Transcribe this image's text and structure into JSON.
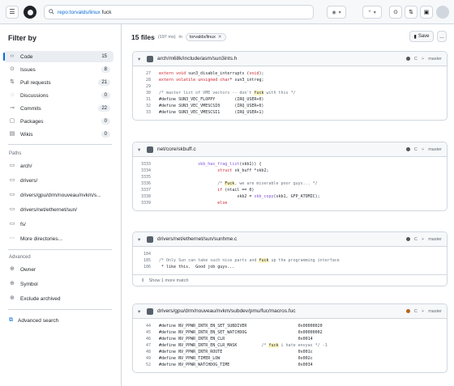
{
  "header": {
    "search_repo": "repo:torvalds/linux",
    "search_term": "fuck"
  },
  "sidebar": {
    "title": "Filter by",
    "items": [
      {
        "label": "Code",
        "count": "15",
        "icon": "code-icon"
      },
      {
        "label": "Issues",
        "count": "8",
        "icon": "issue-icon"
      },
      {
        "label": "Pull requests",
        "count": "21",
        "icon": "pull-request-icon"
      },
      {
        "label": "Discussions",
        "count": "0",
        "icon": "discussion-icon"
      },
      {
        "label": "Commits",
        "count": "22",
        "icon": "commit-icon"
      },
      {
        "label": "Packages",
        "count": "0",
        "icon": "package-icon"
      },
      {
        "label": "Wikis",
        "count": "0",
        "icon": "book-icon"
      }
    ],
    "paths_label": "Paths",
    "paths": [
      {
        "label": "arch/"
      },
      {
        "label": "drivers/"
      },
      {
        "label": "drivers/gpu/drm/nouveau/nvkm/s..."
      },
      {
        "label": "drivers/net/ethernet/sun/"
      },
      {
        "label": "fs/"
      },
      {
        "label": "More directories..."
      }
    ],
    "advanced_label": "Advanced",
    "advanced": [
      {
        "label": "Owner"
      },
      {
        "label": "Symbol"
      },
      {
        "label": "Exclude archived"
      }
    ],
    "advanced_search": "Advanced search"
  },
  "main": {
    "count": "15 files",
    "time": "(197 ms)",
    "in_label": "in",
    "chip": "torvalds/linux",
    "save_label": "Save",
    "more_label": "...",
    "results": [
      {
        "path": "arch/m68k/include/asm/sun3ints.h",
        "lang": "C",
        "branch": "master",
        "lang_color": "#555555",
        "lines": [
          {
            "n": "27",
            "t": "extern void sun3_disable_interrupts (void);"
          },
          {
            "n": "28",
            "t": "extern volatile unsigned char* sun3_intreg;"
          },
          {
            "n": "29",
            "t": ""
          },
          {
            "n": "30",
            "t": "/* master list of VME vectors -- don't fuck with this */"
          },
          {
            "n": "31",
            "t": "#define SUN3_VEC_FLOPPY        (IRQ_USER+0)"
          },
          {
            "n": "32",
            "t": "#define SUN3_VEC_VMESCSI0      (IRQ_USER+0)"
          },
          {
            "n": "33",
            "t": "#define SUN3_VEC_VMESCSI1      (IRQ_USER+1)"
          }
        ]
      },
      {
        "path": "net/core/skbuff.c",
        "lang": "C",
        "branch": "master",
        "lang_color": "#555555",
        "lines": [
          {
            "n": "3333",
            "t": "                skb_has_frag_list(skb1)) {"
          },
          {
            "n": "3334",
            "t": "                        struct sk_buff *skb2;"
          },
          {
            "n": "3335",
            "t": ""
          },
          {
            "n": "3336",
            "t": "                        /* Fuck, we are miserable poor guys... */"
          },
          {
            "n": "3337",
            "t": "                        if (ntail == 0)"
          },
          {
            "n": "3338",
            "t": "                                skb2 = skb_copy(skb1, GFP_ATOMIC);"
          },
          {
            "n": "3339",
            "t": "                        else"
          }
        ]
      },
      {
        "path": "drivers/net/ethernet/sun/sunhme.c",
        "lang": "C",
        "branch": "master",
        "lang_color": "#555555",
        "lines": [
          {
            "n": "184",
            "t": ""
          },
          {
            "n": "185",
            "t": "/* Only Sun can take such nice parts and fuck up the programming interface"
          },
          {
            "n": "186",
            "t": " * like this.  Good job guys..."
          }
        ],
        "show_more": "Show 1 more match"
      },
      {
        "path": "drivers/gpu/drm/nouveau/nvkm/subdev/pmu/fuc/macros.fuc",
        "lang": "C",
        "branch": "master",
        "lang_color": "#b5651d",
        "lines": [
          {
            "n": "44",
            "t": "#define NV_PPWR_INTR_EN_SET_SUBDIVER                     0x00000020"
          },
          {
            "n": "45",
            "t": "#define NV_PPWR_INTR_EN_SET_WATCHDOG                     0x00000002"
          },
          {
            "n": "46",
            "t": "#define NV_PPWR_INTR_EN_CLR                              0x0014"
          },
          {
            "n": "47",
            "t": "#define NV_PPWR_INTR_EN_CLR_MASK          /* fuck i hate envyas */ -1"
          },
          {
            "n": "48",
            "t": "#define NV_PPWR_INTR_ROUTE                               0x001c"
          },
          {
            "n": "49",
            "t": "#define NV_PPWR_TIMER_LOW                                0x002c"
          },
          {
            "n": "52",
            "t": "#define NV_PPWR_WATCHDOG_TIME                            0x0034"
          }
        ]
      }
    ]
  }
}
